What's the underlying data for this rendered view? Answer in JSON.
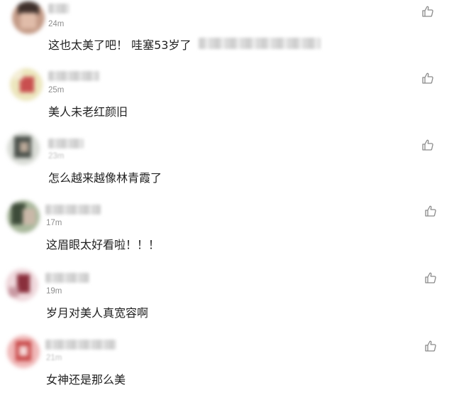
{
  "comments": [
    {
      "time": "24m",
      "text": "这也太美了吧！  哇塞53岁了",
      "avatar": [
        "#7a5e52",
        "#d8b4a2",
        "#3f302b"
      ]
    },
    {
      "time": "25m",
      "text": "美人未老红颜旧",
      "avatar": [
        "#e9e3b3",
        "#c94f4f",
        "#f2ecd0"
      ]
    },
    {
      "time": "23m",
      "text": "怎么越来越像林青霞了",
      "avatar": [
        "#6e7468",
        "#d9dcd6",
        "#2f3530"
      ]
    },
    {
      "time": "17m",
      "text": "这眉眼太好看啦！！！",
      "avatar": [
        "#6f8a62",
        "#c9b8a8",
        "#3e4c3a"
      ]
    },
    {
      "time": "19m",
      "text": "岁月对美人真宽容啊",
      "avatar": [
        "#e8c6cc",
        "#8a2f3c",
        "#f3e3e6"
      ]
    },
    {
      "time": "21m",
      "text": "女神还是那么美",
      "avatar": [
        "#e9a6a6",
        "#c84848",
        "#f5d6d6"
      ]
    }
  ],
  "colors": {
    "text": "#222222",
    "time": "#8f8f8f",
    "icon": "#8a8a8a"
  },
  "icons": {
    "like": "thumbs-up-icon"
  }
}
